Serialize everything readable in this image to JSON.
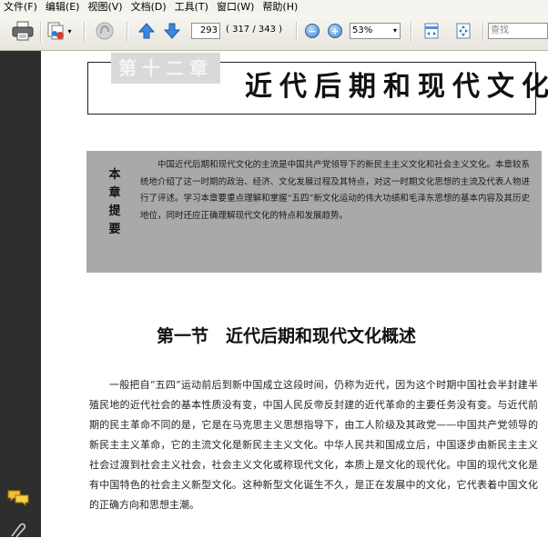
{
  "menu": {
    "items": [
      "文件(F)",
      "编辑(E)",
      "视图(V)",
      "文档(D)",
      "工具(T)",
      "窗口(W)",
      "帮助(H)"
    ]
  },
  "toolbar": {
    "current_page": "293",
    "page_count_text": "( 317 / 343 )",
    "zoom": "53%",
    "search_placeholder": "查找"
  },
  "document": {
    "chapter_number": "第十二章",
    "chapter_title": "近代后期和现代文化",
    "summary_label": [
      "本",
      "章",
      "提",
      "要"
    ],
    "summary_text": "中国近代后期和现代文化的主流是中国共产党领导下的新民主主义文化和社会主义文化。本章较系统地介绍了这一时期的政治、经济、文化发展过程及其特点，对这一时期文化思想的主流及代表人物进行了评述。学习本章要重点理解和掌握“五四”新文化运动的伟大功绩和毛泽东思想的基本内容及其历史地位，同时还应正确理解现代文化的特点和发展趋势。",
    "section_title": "第一节　近代后期和现代文化概述",
    "body_text": "一般把自“五四”运动前后到新中国成立这段时间，仍称为近代，因为这个时期中国社会半封建半殖民地的近代社会的基本性质没有变，中国人民反帝反封建的近代革命的主要任务没有变。与近代前期的民主革命不同的是，它是在马克思主义思想指导下，由工人阶级及其政党——中国共产党领导的新民主主义革命，它的主流文化是新民主主义文化。中华人民共和国成立后，中国逐步由新民主主义社会过渡到社会主义社会，社会主义文化或称现代文化，本质上是文化的现代化。中国的现代文化是有中国特色的社会主义新型文化。这种新型文化诞生不久，是正在发展中的文化，它代表着中国文化的正确方向和思想主潮。"
  }
}
